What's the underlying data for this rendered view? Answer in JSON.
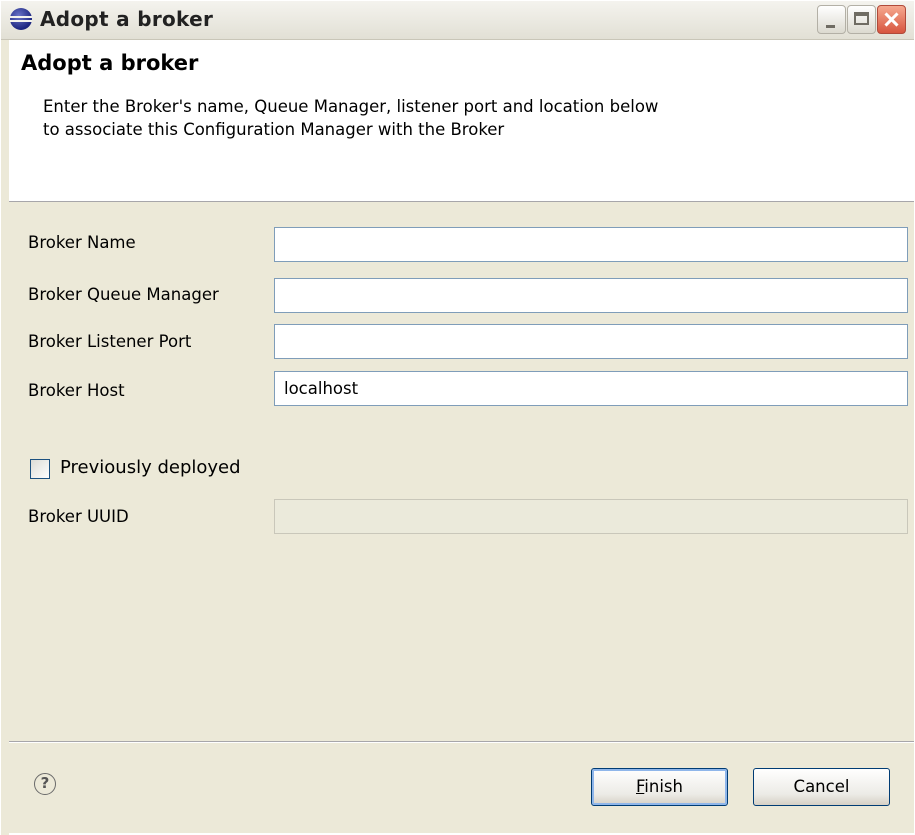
{
  "window": {
    "title": "Adopt a broker"
  },
  "header": {
    "title": "Adopt a broker",
    "description_line1": "Enter the Broker's name, Queue Manager, listener port and location below",
    "description_line2": "to associate this Configuration Manager with the Broker"
  },
  "form": {
    "broker_name_label": "Broker Name",
    "broker_name_value": "",
    "queue_manager_label": "Broker Queue Manager",
    "queue_manager_value": "",
    "listener_port_label": "Broker Listener Port",
    "listener_port_value": "",
    "host_label": "Broker Host",
    "host_value": "localhost",
    "previously_deployed_label": "Previously deployed",
    "previously_deployed_checked": false,
    "uuid_label": "Broker UUID",
    "uuid_value": ""
  },
  "footer": {
    "help_glyph": "?",
    "finish_mnemonic": "F",
    "finish_rest": "inish",
    "cancel_label": "Cancel"
  }
}
